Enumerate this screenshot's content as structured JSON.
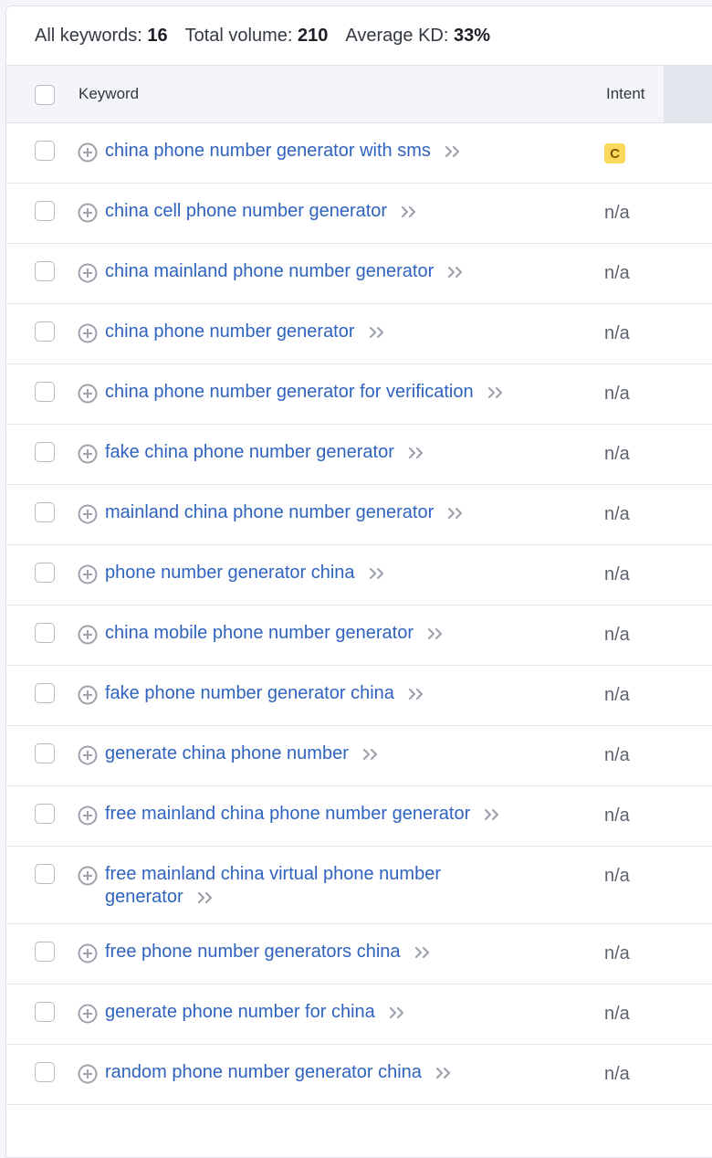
{
  "summary": {
    "all_keywords_label": "All keywords:",
    "all_keywords_value": "16",
    "total_volume_label": "Total volume:",
    "total_volume_value": "210",
    "average_kd_label": "Average KD:",
    "average_kd_value": "33%"
  },
  "header": {
    "keyword": "Keyword",
    "intent": "Intent"
  },
  "colors": {
    "link": "#2f63bd",
    "intent_badge_bg": "#fbd85a"
  },
  "rows": [
    {
      "keyword": "china phone number generator with sms",
      "intent": "C",
      "intent_is_badge": true
    },
    {
      "keyword": "china cell phone number generator",
      "intent": "n/a"
    },
    {
      "keyword": "china mainland phone number generator",
      "intent": "n/a"
    },
    {
      "keyword": "china phone number generator",
      "intent": "n/a"
    },
    {
      "keyword": "china phone number generator for verification",
      "intent": "n/a"
    },
    {
      "keyword": "fake china phone number generator",
      "intent": "n/a"
    },
    {
      "keyword": "mainland china phone number generator",
      "intent": "n/a"
    },
    {
      "keyword": "phone number generator china",
      "intent": "n/a"
    },
    {
      "keyword": "china mobile phone number generator",
      "intent": "n/a"
    },
    {
      "keyword": "fake phone number generator china",
      "intent": "n/a"
    },
    {
      "keyword": "generate china phone number",
      "intent": "n/a"
    },
    {
      "keyword": "free mainland china phone number generator",
      "intent": "n/a"
    },
    {
      "keyword": "free mainland china virtual phone number generator",
      "intent": "n/a"
    },
    {
      "keyword": "free phone number generators china",
      "intent": "n/a"
    },
    {
      "keyword": "generate phone number for china",
      "intent": "n/a"
    },
    {
      "keyword": "random phone number generator china",
      "intent": "n/a"
    }
  ],
  "icons": {
    "row_add": "plus-circle-icon",
    "row_expand": "double-chevron-right-icon"
  }
}
